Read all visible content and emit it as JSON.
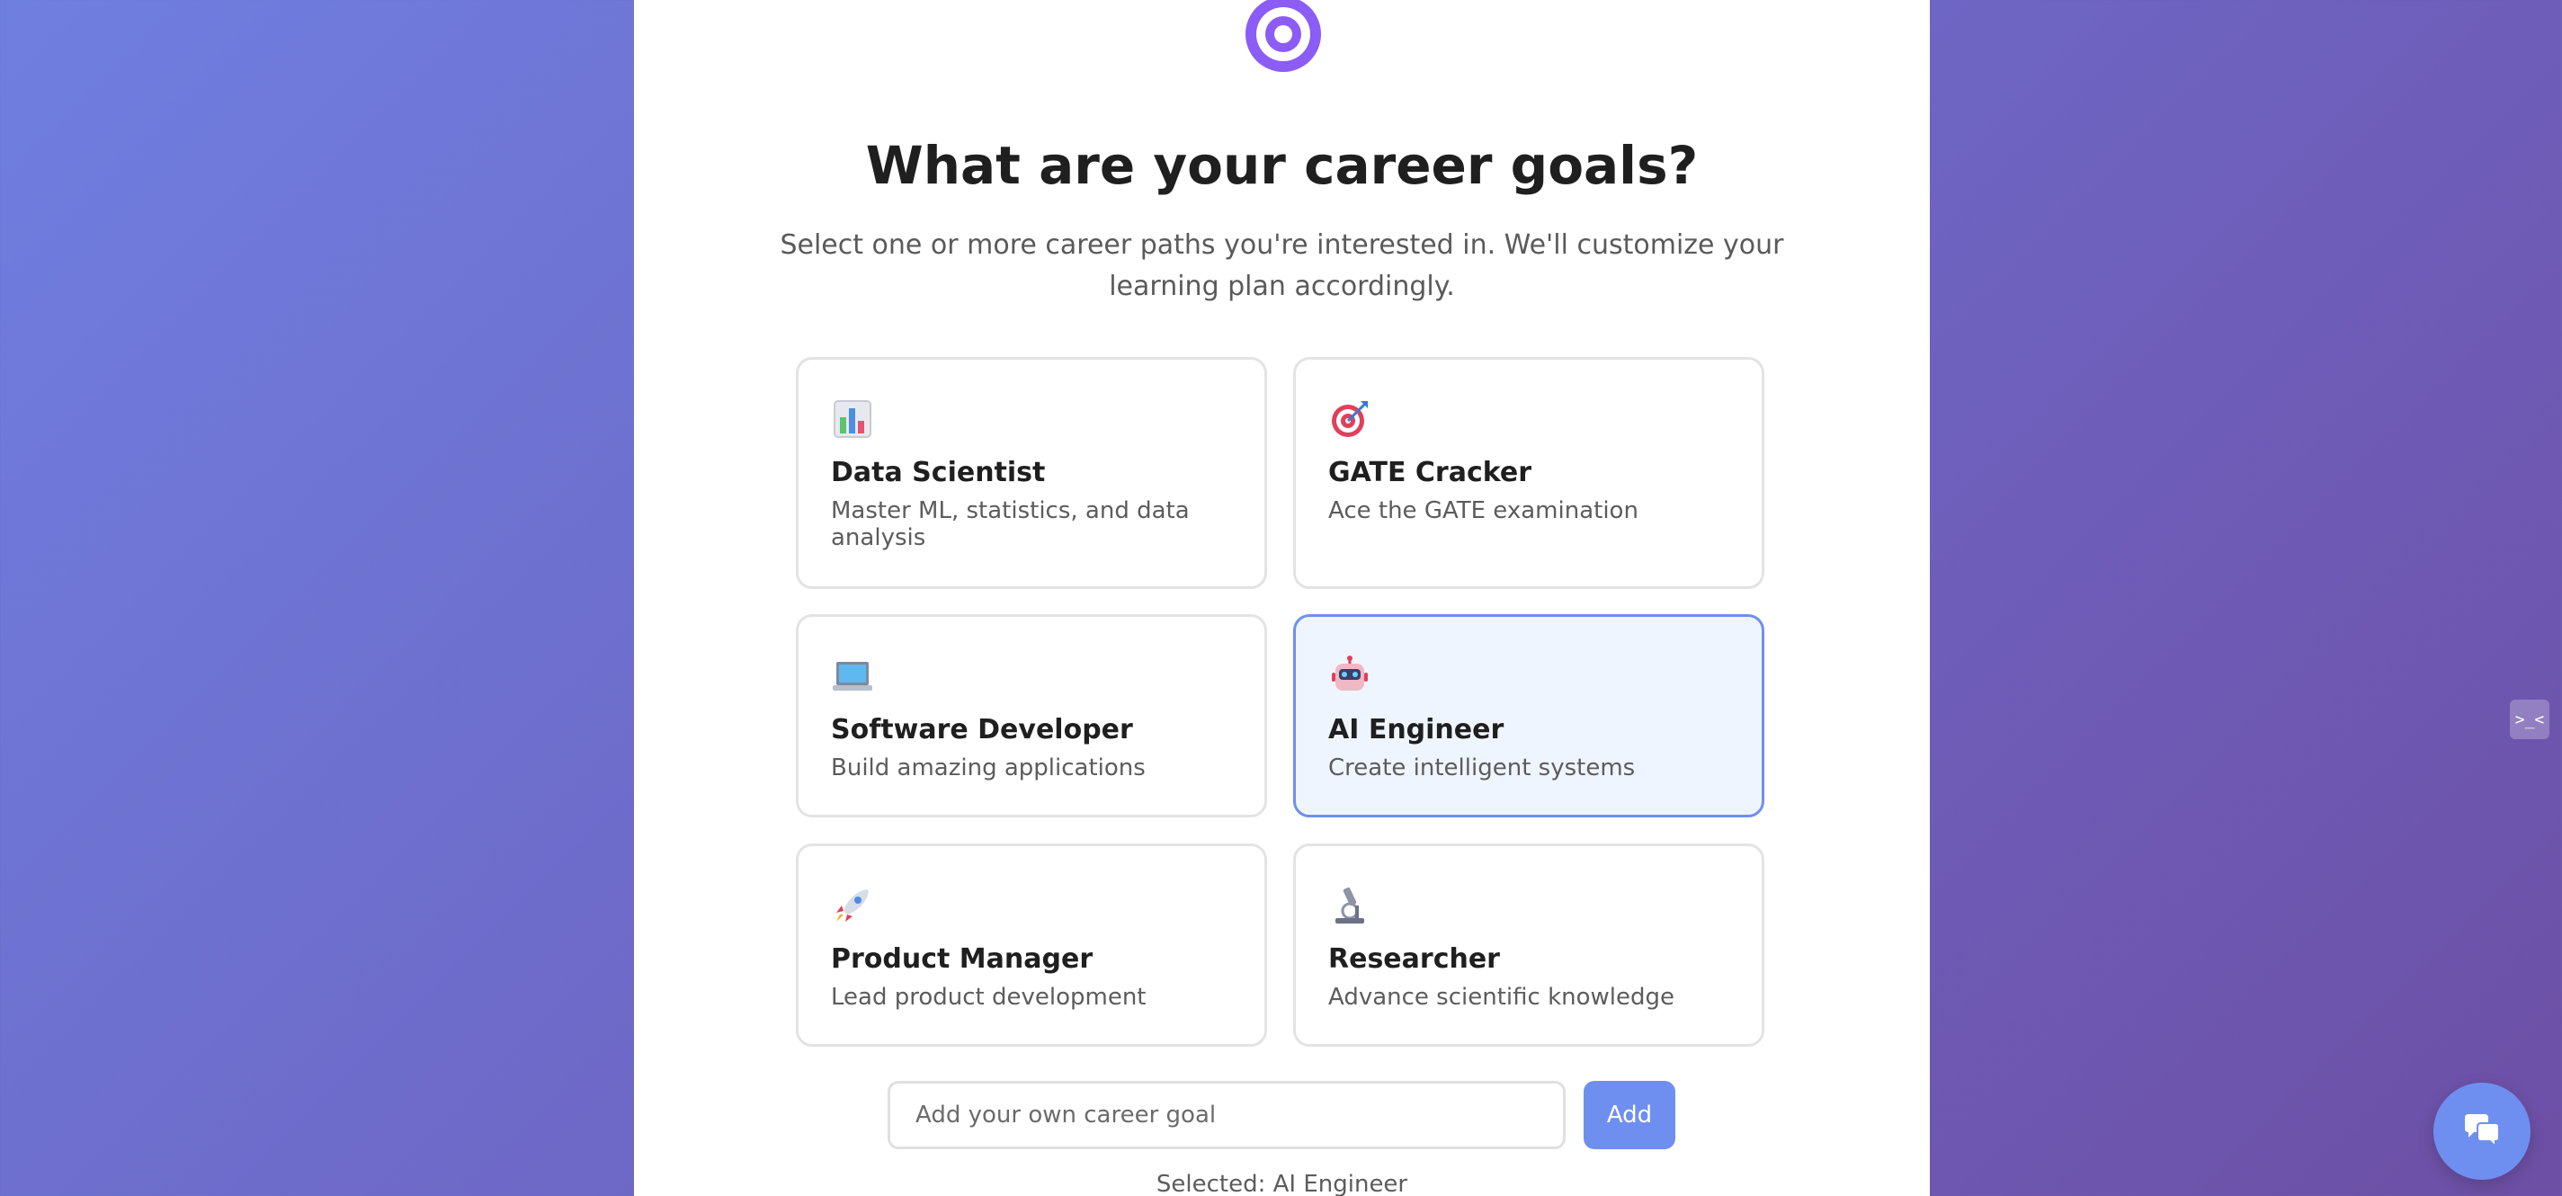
{
  "header": {
    "title": "What are your career goals?",
    "subtitle": "Select one or more career paths you're interested in. We'll customize your learning plan accordingly."
  },
  "careers": [
    {
      "name": "Data Scientist",
      "description": "Master ML, statistics, and data analysis",
      "icon": "bar-chart-icon",
      "selected": false
    },
    {
      "name": "GATE Cracker",
      "description": "Ace the GATE examination",
      "icon": "target-dart-icon",
      "selected": false
    },
    {
      "name": "Software Developer",
      "description": "Build amazing applications",
      "icon": "laptop-icon",
      "selected": false
    },
    {
      "name": "AI Engineer",
      "description": "Create intelligent systems",
      "icon": "robot-icon",
      "selected": true
    },
    {
      "name": "Product Manager",
      "description": "Lead product development",
      "icon": "rocket-icon",
      "selected": false
    },
    {
      "name": "Researcher",
      "description": "Advance scientific knowledge",
      "icon": "microscope-icon",
      "selected": false
    }
  ],
  "custom_goal": {
    "placeholder": "Add your own career goal",
    "value": "",
    "button_label": "Add"
  },
  "selected_summary": "Selected: AI Engineer",
  "side_handle_label": ">_<",
  "colors": {
    "accent": "#6f8ff0",
    "logo": "#8b5cf6",
    "selected_card_bg": "#eff5ff"
  }
}
